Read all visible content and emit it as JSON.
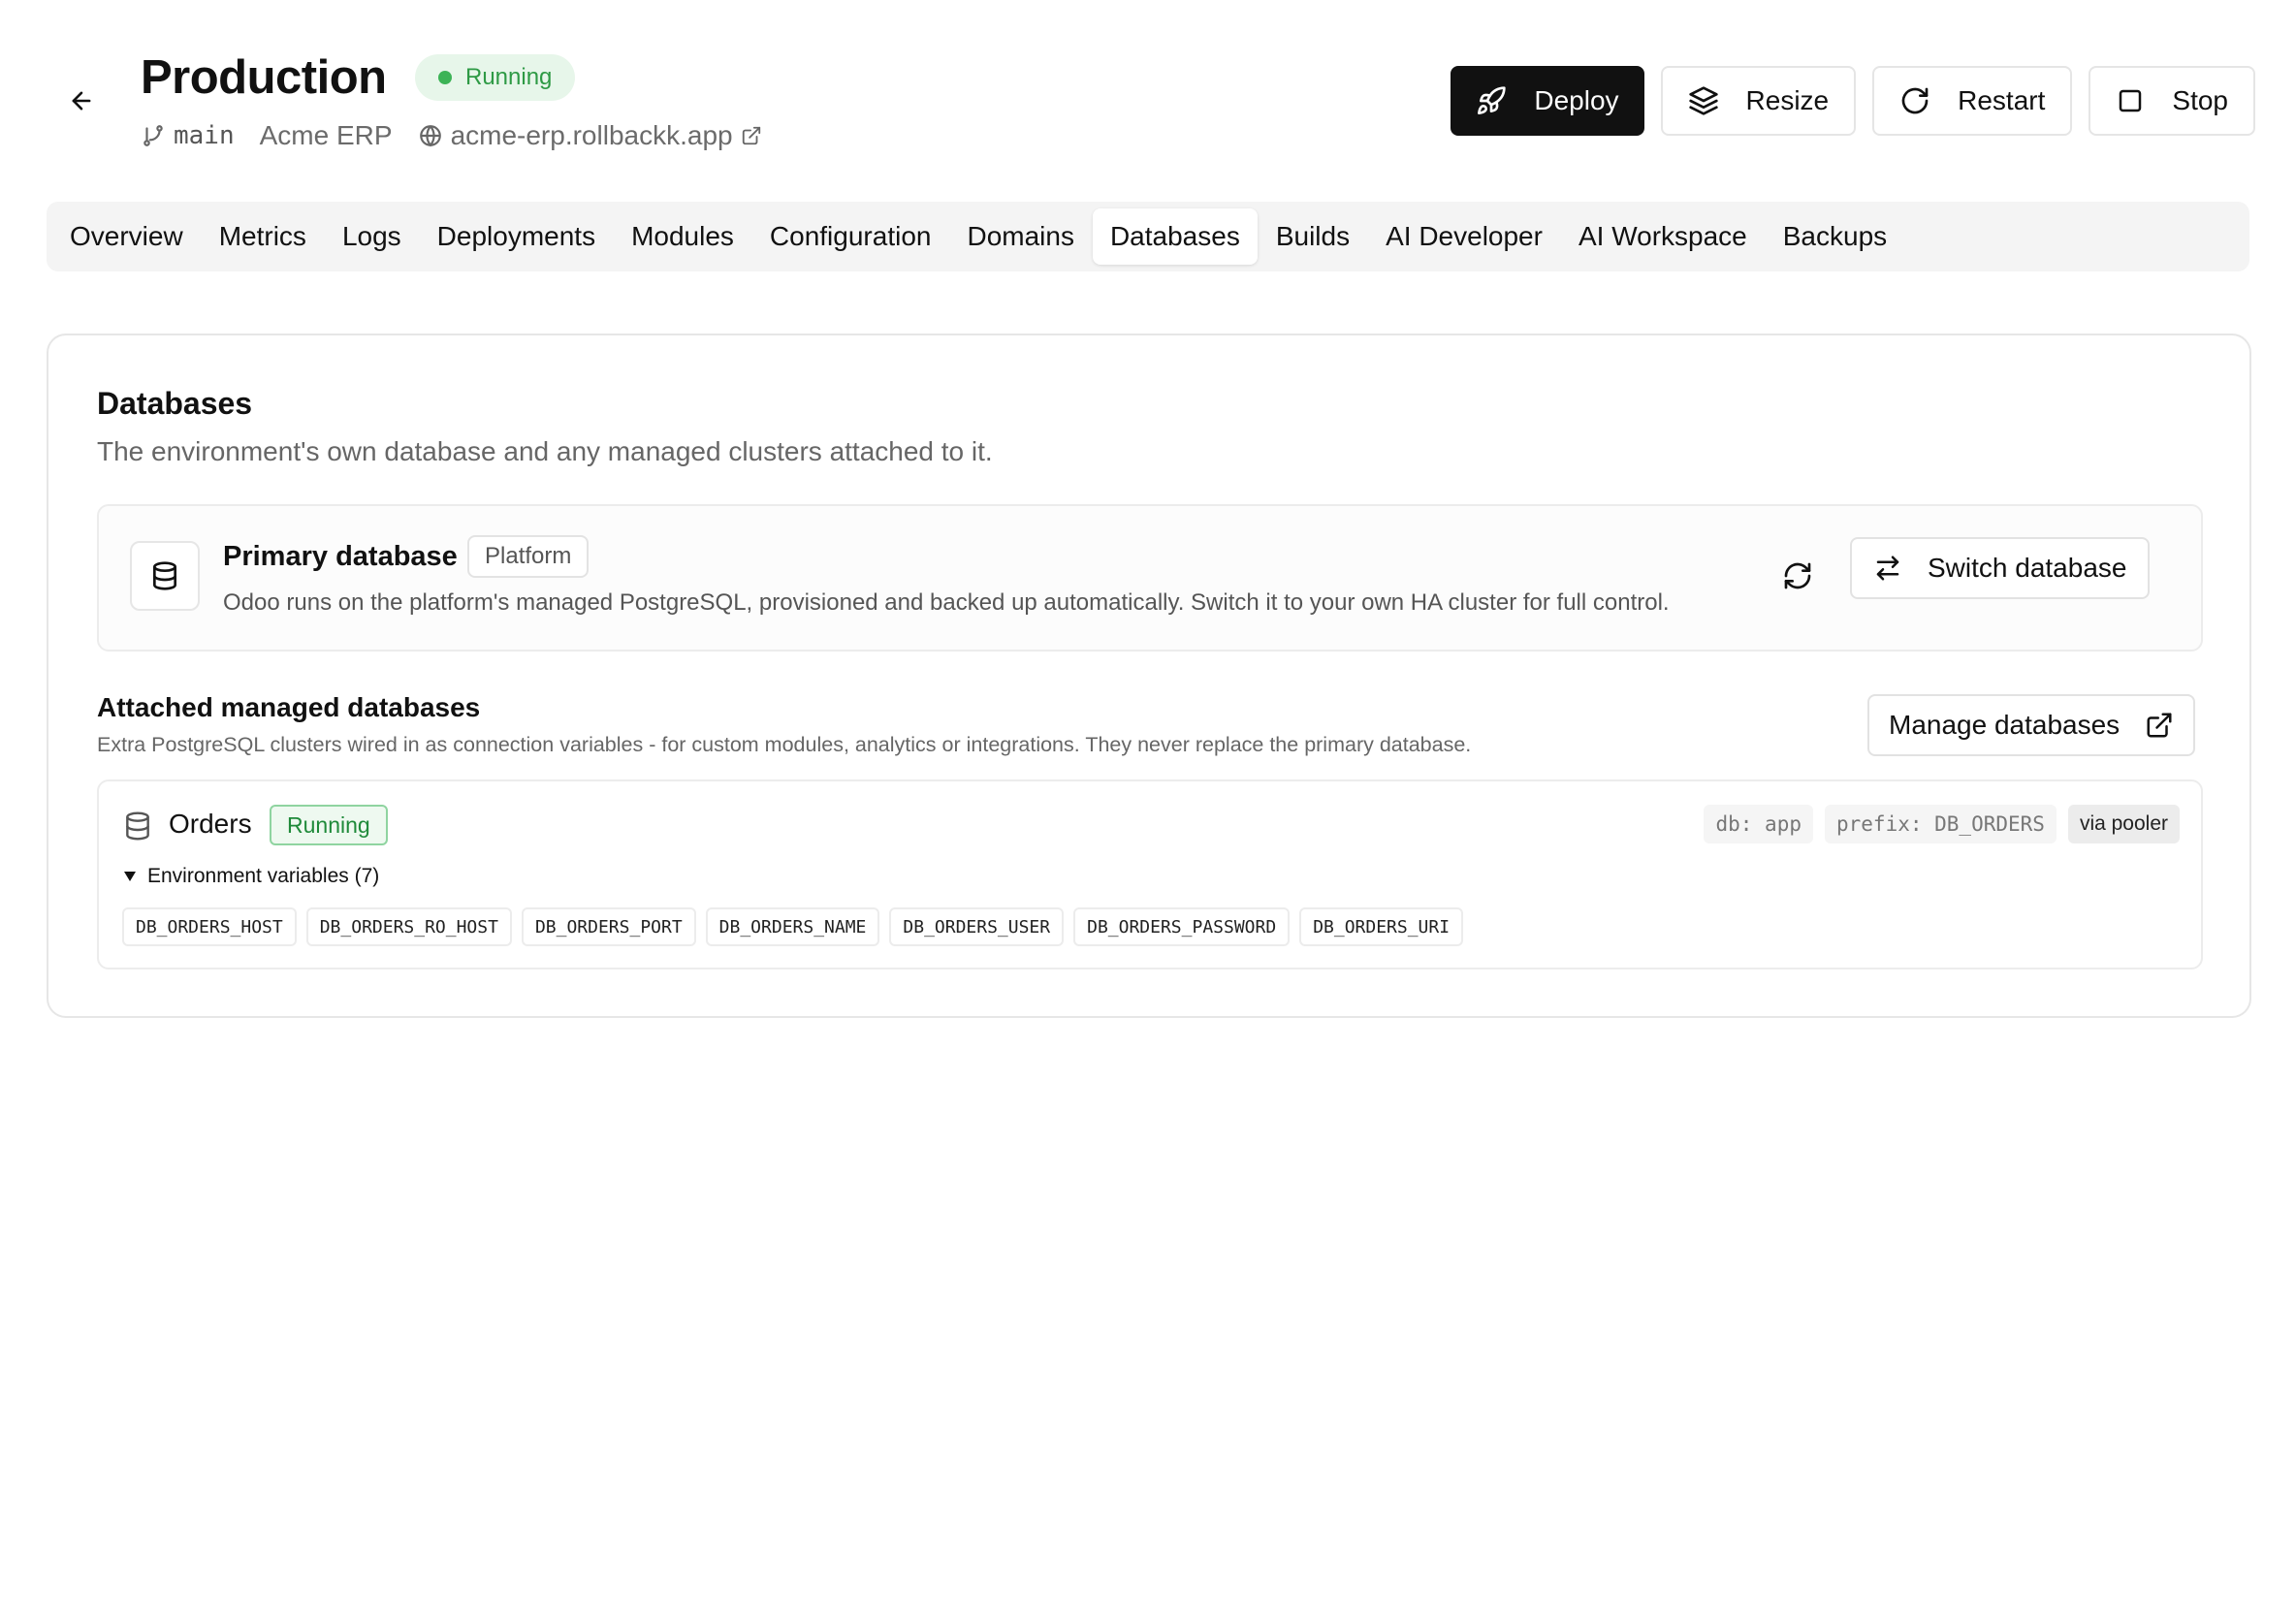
{
  "header": {
    "title": "Production",
    "status": "Running",
    "branch": "main",
    "project": "Acme ERP",
    "domain": "acme-erp.rollbackk.app"
  },
  "actions": {
    "deploy": "Deploy",
    "resize": "Resize",
    "restart": "Restart",
    "stop": "Stop"
  },
  "tabs": [
    {
      "label": "Overview"
    },
    {
      "label": "Metrics"
    },
    {
      "label": "Logs"
    },
    {
      "label": "Deployments"
    },
    {
      "label": "Modules"
    },
    {
      "label": "Configuration"
    },
    {
      "label": "Domains"
    },
    {
      "label": "Databases",
      "active": true
    },
    {
      "label": "Builds"
    },
    {
      "label": "AI Developer"
    },
    {
      "label": "AI Workspace"
    },
    {
      "label": "Backups"
    }
  ],
  "databases": {
    "title": "Databases",
    "subtitle": "The environment's own database and any managed clusters attached to it.",
    "primary": {
      "title": "Primary database",
      "badge": "Platform",
      "description": "Odoo runs on the platform's managed PostgreSQL, provisioned and backed up automatically. Switch it to your own HA cluster for full control.",
      "switch_label": "Switch database"
    },
    "attached": {
      "title": "Attached managed databases",
      "subtitle": "Extra PostgreSQL clusters wired in as connection variables - for custom modules, analytics or integrations. They never replace the primary database.",
      "manage_label": "Manage databases",
      "items": [
        {
          "name": "Orders",
          "status": "Running",
          "db": "db: app",
          "prefix": "prefix: DB_ORDERS",
          "pooler": "via pooler",
          "env_label": "Environment variables (7)",
          "env_vars": [
            "DB_ORDERS_HOST",
            "DB_ORDERS_RO_HOST",
            "DB_ORDERS_PORT",
            "DB_ORDERS_NAME",
            "DB_ORDERS_USER",
            "DB_ORDERS_PASSWORD",
            "DB_ORDERS_URI"
          ]
        }
      ]
    }
  },
  "colors": {
    "accent_dark": "#111111",
    "running_green": "#2e9a45",
    "running_bg": "#e7f6ea"
  }
}
